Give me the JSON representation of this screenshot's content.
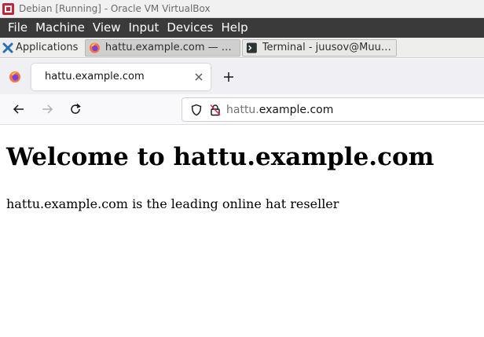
{
  "vbox": {
    "title": "Debian [Running] - Oracle VM VirtualBox",
    "menu": [
      "File",
      "Machine",
      "View",
      "Input",
      "Devices",
      "Help"
    ]
  },
  "guest_panel": {
    "apps_label": "Applications",
    "tasks": [
      {
        "label": "hattu.example.com — Mo…",
        "icon": "firefox-icon",
        "active": true
      },
      {
        "label": "Terminal - juusov@Muumi…",
        "icon": "terminal-icon",
        "active": false
      }
    ]
  },
  "firefox": {
    "tab_title": "hattu.example.com",
    "url_subdomain": "hattu.",
    "url_domain": "example.com",
    "accent": "#ff7139"
  },
  "page": {
    "heading": "Welcome to hattu.example.com",
    "paragraph": "hattu.example.com is the leading online hat reseller"
  }
}
